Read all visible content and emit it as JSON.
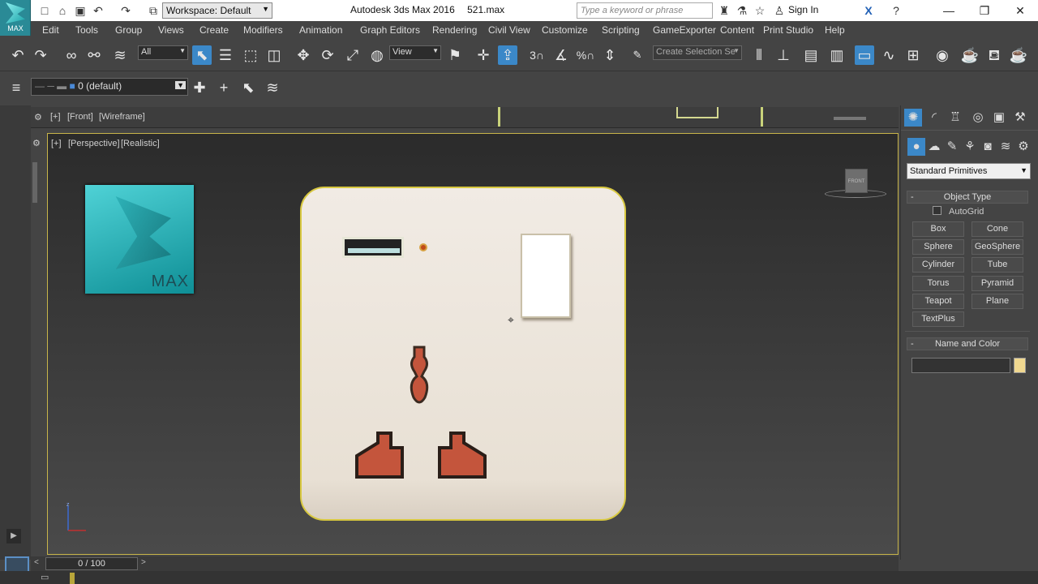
{
  "app": {
    "logo_text": "MAX",
    "workspace": "Workspace: Default",
    "title": "Autodesk 3ds Max 2016",
    "file": "521.max",
    "search_placeholder": "Type a keyword or phrase",
    "sign_in": "Sign In"
  },
  "menus": [
    "Edit",
    "Tools",
    "Group",
    "Views",
    "Create",
    "Modifiers",
    "Animation",
    "Graph Editors",
    "Rendering",
    "Civil View",
    "Customize",
    "Scripting",
    "GameExporter",
    "Content",
    "Print Studio",
    "Help"
  ],
  "toolbar": {
    "filter": "All",
    "ref_coord": "View",
    "selection_set": "Create Selection Se"
  },
  "layer": {
    "current": "0 (default)"
  },
  "viewports": {
    "front": {
      "plus": "[+]",
      "name": "[Front]",
      "shading": "[Wireframe]"
    },
    "perspective": {
      "plus": "[+]",
      "name": "[Perspective]",
      "shading": "[Realistic]"
    }
  },
  "navcube": {
    "face": "FRONT"
  },
  "overlay": {
    "tile_label": "MAX"
  },
  "command_panel": {
    "category": "Standard Primitives",
    "object_type_title": "Object Type",
    "autogrid": "AutoGrid",
    "buttons": [
      "Box",
      "Cone",
      "Sphere",
      "GeoSphere",
      "Cylinder",
      "Tube",
      "Torus",
      "Pyramid",
      "Teapot",
      "Plane",
      "TextPlus"
    ],
    "name_color_title": "Name and Color",
    "color": "#f0d890"
  },
  "timeline": {
    "position": "0 / 100"
  },
  "axis": {
    "z": "z"
  }
}
